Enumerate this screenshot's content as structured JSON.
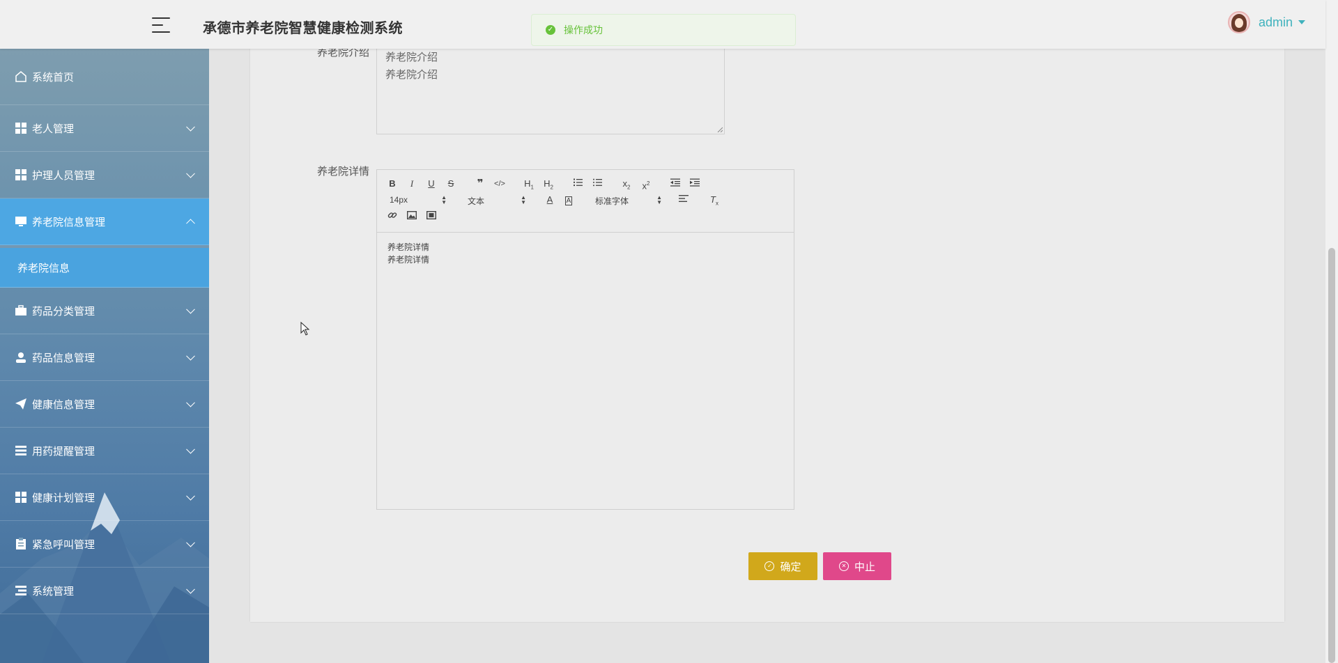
{
  "header": {
    "title": "承德市养老院智慧健康检测系统",
    "toast": "操作成功",
    "user_name": "admin"
  },
  "sidebar": {
    "items": [
      {
        "label": "系统首页",
        "icon": "home-icon"
      },
      {
        "label": "老人管理",
        "icon": "grid-icon"
      },
      {
        "label": "护理人员管理",
        "icon": "grid-icon"
      },
      {
        "label": "养老院信息管理",
        "icon": "monitor-icon",
        "expanded": true
      },
      {
        "label": "药品分类管理",
        "icon": "briefcase-icon"
      },
      {
        "label": "药品信息管理",
        "icon": "user-icon"
      },
      {
        "label": "健康信息管理",
        "icon": "paper-plane-icon"
      },
      {
        "label": "用药提醒管理",
        "icon": "list-icon"
      },
      {
        "label": "健康计划管理",
        "icon": "grid-icon"
      },
      {
        "label": "紧急呼叫管理",
        "icon": "clipboard-icon"
      },
      {
        "label": "系统管理",
        "icon": "menu-icon"
      }
    ],
    "sub_item": "养老院信息"
  },
  "form": {
    "intro_label": "养老院介绍",
    "intro_value": "养老院介绍\n养老院介绍",
    "detail_label": "养老院详情",
    "editor": {
      "font_size": "14px",
      "block_format": "文本",
      "font_family": "标准字体",
      "content_line1": "养老院详情",
      "content_line2": "养老院详情"
    },
    "confirm_label": "确定",
    "cancel_label": "中止"
  },
  "colors": {
    "toast_text": "#67c23a",
    "sidebar_active": "#4da7e3",
    "confirm_button": "#d1a81b",
    "cancel_button": "#e0488a",
    "user_name": "#3fb2bd"
  }
}
